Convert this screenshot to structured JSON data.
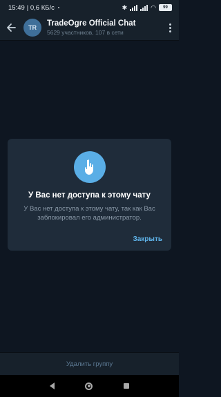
{
  "status_bar": {
    "time": "15:49",
    "net_speed": "| 0,6 КБ/с",
    "battery": "99"
  },
  "header": {
    "avatar_initials": "TR",
    "title": "TradeOgre Official Chat",
    "subtitle": "5629 участников, 107 в сети"
  },
  "dialog": {
    "title": "У Вас нет доступа к этому чату",
    "message": "У Вас нет доступа к этому чату, так как Вас заблокировал его администратор.",
    "close_label": "Закрыть",
    "icon_color": "#5aaee6"
  },
  "bottom": {
    "delete_label": "Удалить группу"
  },
  "colors": {
    "background": "#0e1621",
    "header": "#17212b",
    "dialog": "#1f2c3a",
    "accent": "#5fb4ea"
  }
}
